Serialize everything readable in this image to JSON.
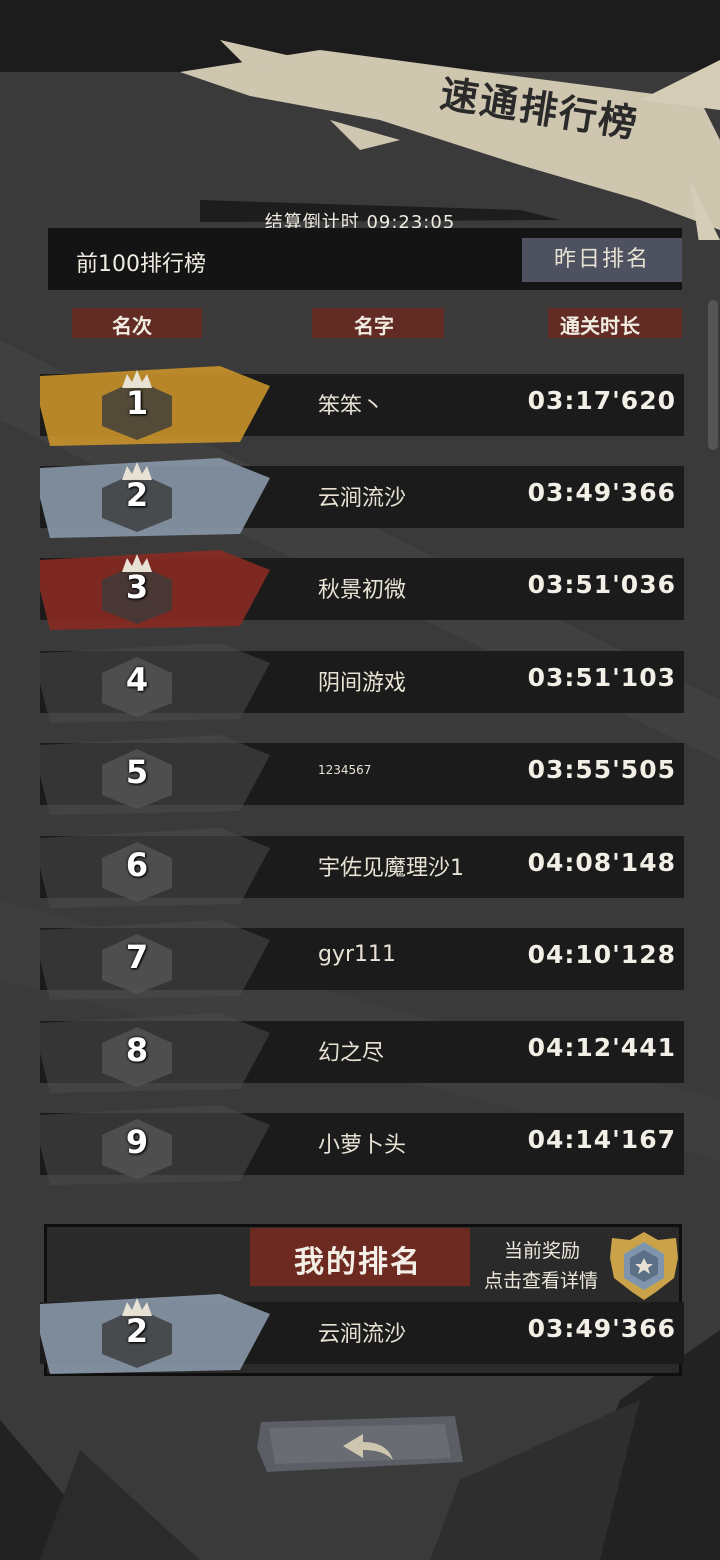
{
  "header": {
    "title": "速通排行榜",
    "countdown_label": "结算倒计时",
    "countdown_value": "09:23:05",
    "top100_label": "前100排行榜",
    "yesterday_button": "昨日排名"
  },
  "columns": {
    "rank": "名次",
    "name": "名字",
    "time": "通关时长"
  },
  "rows": [
    {
      "rank": "1",
      "name": "笨笨丶",
      "time": "03:17'620",
      "tier": "gold"
    },
    {
      "rank": "2",
      "name": "云涧流沙",
      "time": "03:49'366",
      "tier": "silver"
    },
    {
      "rank": "3",
      "name": "秋景初微",
      "time": "03:51'036",
      "tier": "bronze"
    },
    {
      "rank": "4",
      "name": "阴间游戏",
      "time": "03:51'103",
      "tier": "gray"
    },
    {
      "rank": "5",
      "name": "1234567",
      "time": "03:55'505",
      "tier": "gray"
    },
    {
      "rank": "6",
      "name": "宇佐见魔理沙1",
      "time": "04:08'148",
      "tier": "gray"
    },
    {
      "rank": "7",
      "name": "gyr111",
      "time": "04:10'128",
      "tier": "gray"
    },
    {
      "rank": "8",
      "name": "幻之尽",
      "time": "04:12'441",
      "tier": "gray"
    },
    {
      "rank": "9",
      "name": "小萝卜头",
      "time": "04:14'167",
      "tier": "gray"
    }
  ],
  "my_rank": {
    "title": "我的排名",
    "reward_label": "当前奖励",
    "reward_detail": "点击查看详情",
    "rank": "2",
    "name": "云涧流沙",
    "time": "03:49'366",
    "tier": "silver"
  },
  "icons": {
    "back": "back-arrow-icon",
    "reward": "reward-medal-icon",
    "crown": "crown-icon"
  },
  "colors": {
    "gold": "#c8922a",
    "silver": "#8a98a8",
    "bronze": "#8a2a24",
    "gray": "#4a4a4a",
    "accent_red": "#6d2a21",
    "button_blue": "#4e5160"
  }
}
